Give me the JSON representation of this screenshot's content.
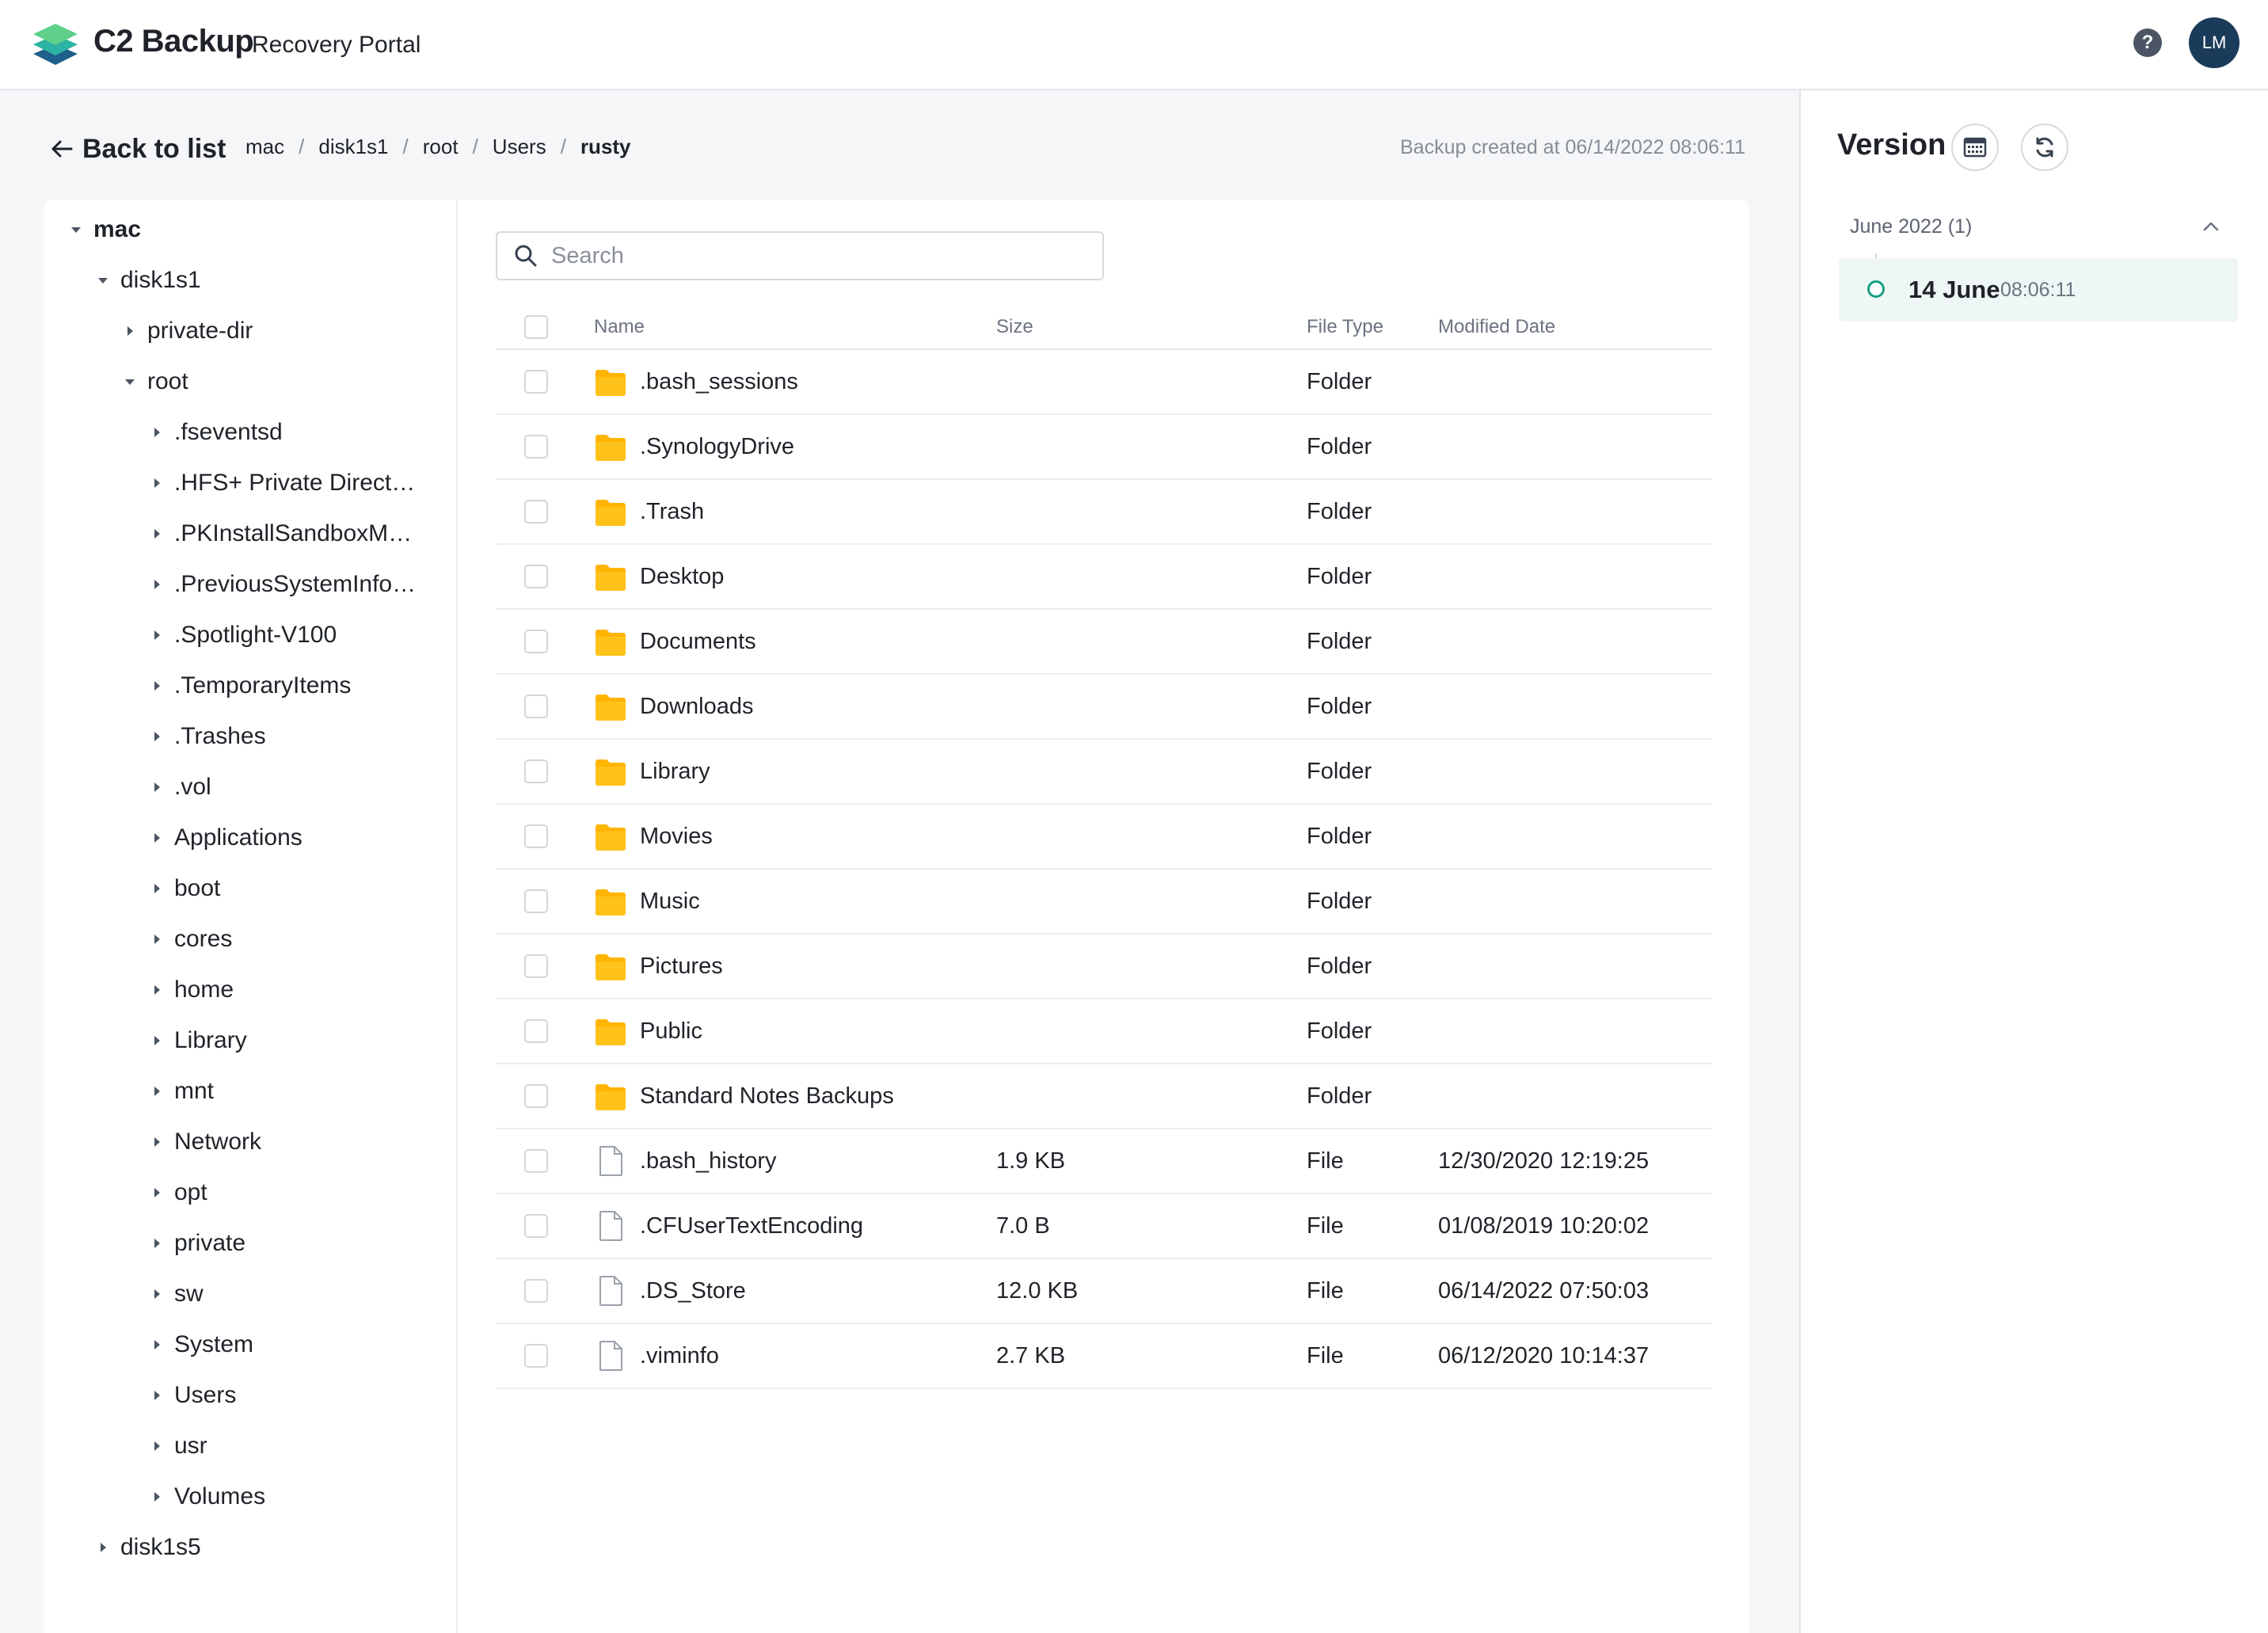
{
  "header": {
    "brand": "C2 Backup",
    "subtitle": "Recovery Portal",
    "help_icon": "question-circle-icon",
    "help_glyph": "?",
    "avatar_initials": "LM"
  },
  "nav": {
    "back_label": "Back to list",
    "breadcrumb": [
      "mac",
      "disk1s1",
      "root",
      "Users",
      "rusty"
    ],
    "backup_created": "Backup created at 06/14/2022 08:06:11"
  },
  "tree": [
    {
      "label": "mac",
      "expanded": true
    },
    {
      "label": "disk1s1",
      "expanded": true
    },
    {
      "label": "private-dir",
      "expanded": false
    },
    {
      "label": "root",
      "expanded": true
    },
    {
      "label": ".fseventsd",
      "expanded": false
    },
    {
      "label": ".HFS+ Private Direct…",
      "expanded": false
    },
    {
      "label": ".PKInstallSandboxM…",
      "expanded": false
    },
    {
      "label": ".PreviousSystemInfo…",
      "expanded": false
    },
    {
      "label": ".Spotlight-V100",
      "expanded": false
    },
    {
      "label": ".TemporaryItems",
      "expanded": false
    },
    {
      "label": ".Trashes",
      "expanded": false
    },
    {
      "label": ".vol",
      "expanded": false
    },
    {
      "label": "Applications",
      "expanded": false
    },
    {
      "label": "boot",
      "expanded": false
    },
    {
      "label": "cores",
      "expanded": false
    },
    {
      "label": "home",
      "expanded": false
    },
    {
      "label": "Library",
      "expanded": false
    },
    {
      "label": "mnt",
      "expanded": false
    },
    {
      "label": "Network",
      "expanded": false
    },
    {
      "label": "opt",
      "expanded": false
    },
    {
      "label": "private",
      "expanded": false
    },
    {
      "label": "sw",
      "expanded": false
    },
    {
      "label": "System",
      "expanded": false
    },
    {
      "label": "Users",
      "expanded": false
    },
    {
      "label": "usr",
      "expanded": false
    },
    {
      "label": "Volumes",
      "expanded": false
    },
    {
      "label": "disk1s5",
      "expanded": false
    }
  ],
  "search": {
    "placeholder": "Search",
    "value": ""
  },
  "table": {
    "columns": {
      "name": "Name",
      "size": "Size",
      "type": "File Type",
      "modified": "Modified Date"
    },
    "rows": [
      {
        "name": ".bash_sessions",
        "size": "",
        "type": "Folder",
        "modified": "",
        "icon": "folder-icon"
      },
      {
        "name": ".SynologyDrive",
        "size": "",
        "type": "Folder",
        "modified": "",
        "icon": "folder-icon"
      },
      {
        "name": ".Trash",
        "size": "",
        "type": "Folder",
        "modified": "",
        "icon": "folder-icon"
      },
      {
        "name": "Desktop",
        "size": "",
        "type": "Folder",
        "modified": "",
        "icon": "folder-icon"
      },
      {
        "name": "Documents",
        "size": "",
        "type": "Folder",
        "modified": "",
        "icon": "folder-icon"
      },
      {
        "name": "Downloads",
        "size": "",
        "type": "Folder",
        "modified": "",
        "icon": "folder-icon"
      },
      {
        "name": "Library",
        "size": "",
        "type": "Folder",
        "modified": "",
        "icon": "folder-icon"
      },
      {
        "name": "Movies",
        "size": "",
        "type": "Folder",
        "modified": "",
        "icon": "folder-icon"
      },
      {
        "name": "Music",
        "size": "",
        "type": "Folder",
        "modified": "",
        "icon": "folder-icon"
      },
      {
        "name": "Pictures",
        "size": "",
        "type": "Folder",
        "modified": "",
        "icon": "folder-icon"
      },
      {
        "name": "Public",
        "size": "",
        "type": "Folder",
        "modified": "",
        "icon": "folder-icon"
      },
      {
        "name": "Standard Notes Backups",
        "size": "",
        "type": "Folder",
        "modified": "",
        "icon": "folder-icon"
      },
      {
        "name": ".bash_history",
        "size": "1.9 KB",
        "type": "File",
        "modified": "12/30/2020 12:19:25",
        "icon": "file-icon"
      },
      {
        "name": ".CFUserTextEncoding",
        "size": "7.0 B",
        "type": "File",
        "modified": "01/08/2019 10:20:02",
        "icon": "file-icon"
      },
      {
        "name": ".DS_Store",
        "size": "12.0 KB",
        "type": "File",
        "modified": "06/14/2022 07:50:03",
        "icon": "file-icon"
      },
      {
        "name": ".viminfo",
        "size": "2.7 KB",
        "type": "File",
        "modified": "06/12/2020 10:14:37",
        "icon": "file-icon"
      }
    ]
  },
  "version": {
    "title": "Version",
    "calendar_icon": "calendar-icon",
    "refresh_icon": "refresh-icon",
    "month": "June 2022 (1)",
    "entry_date": "14 June",
    "entry_time": "08:06:11"
  },
  "colors": {
    "folder": "#FFB400",
    "accent_teal": "#16A085",
    "avatar_bg": "#1B3B5A",
    "selected_entry_bg": "#EEF7F5"
  }
}
